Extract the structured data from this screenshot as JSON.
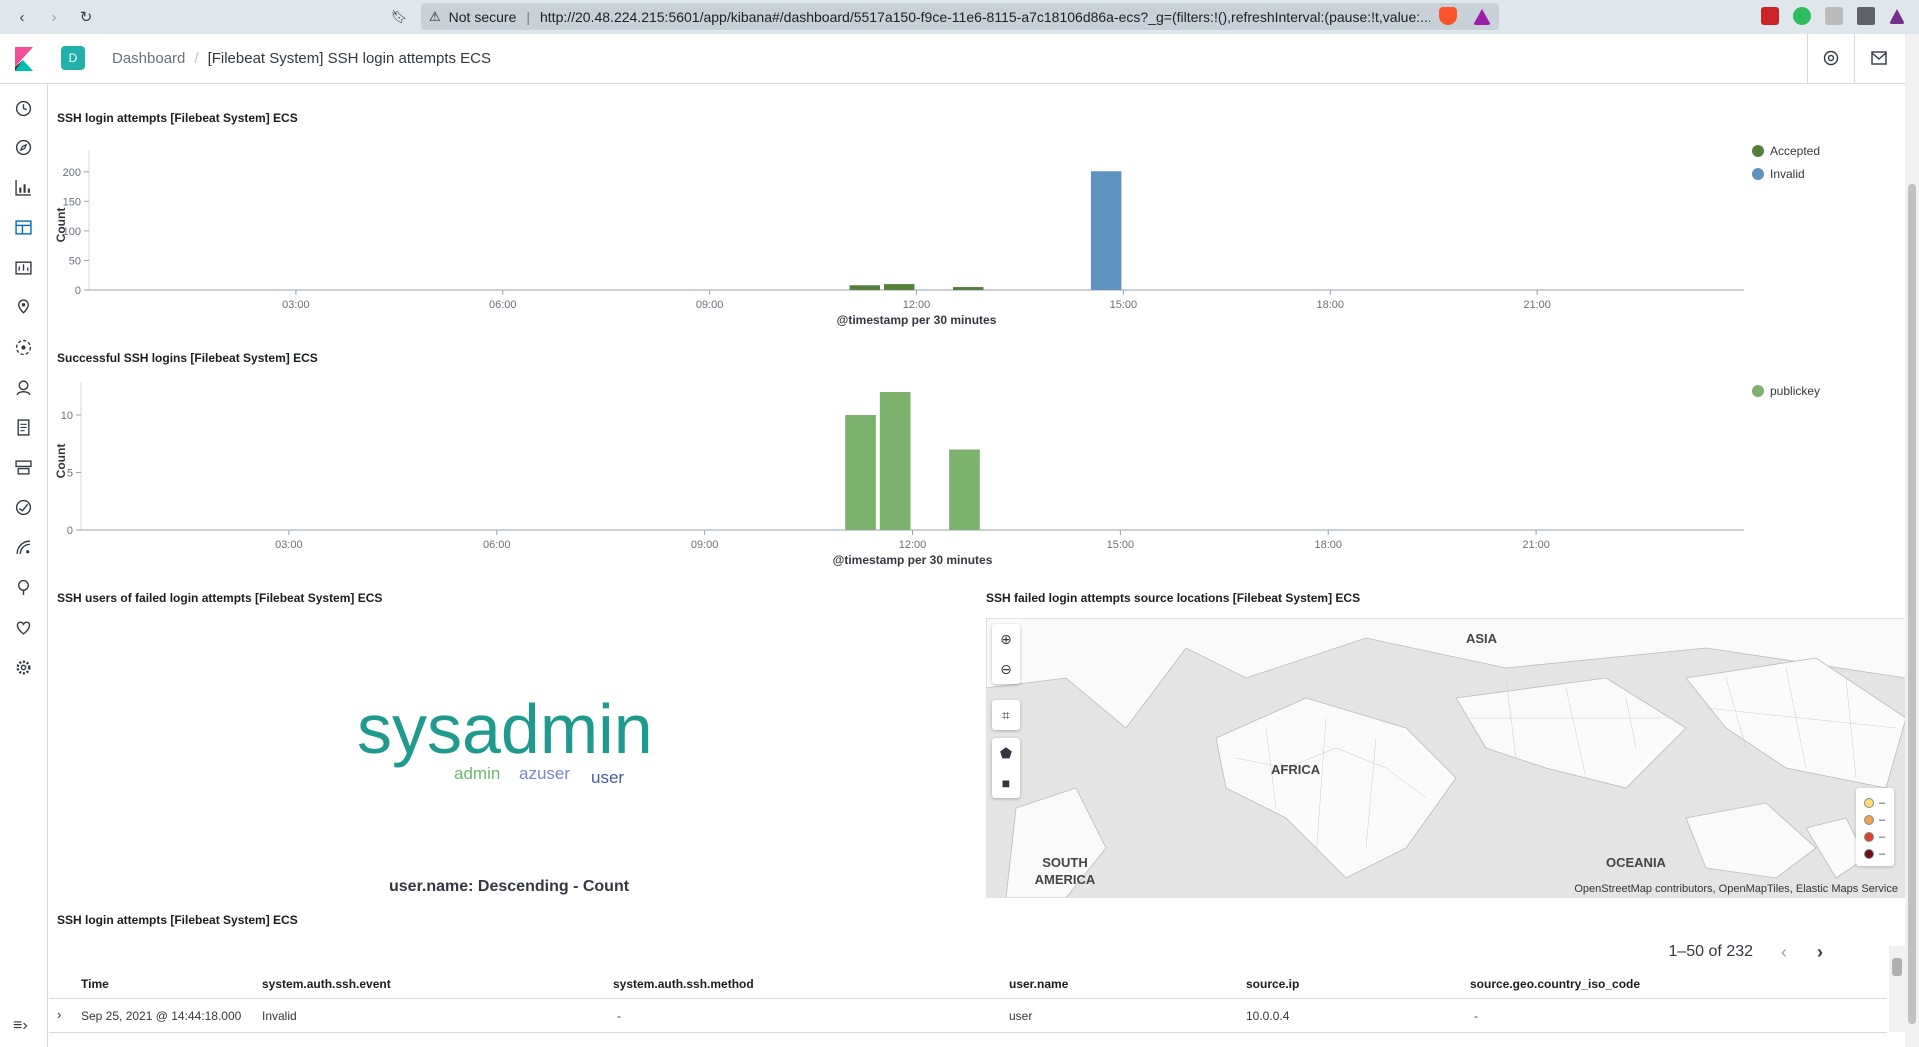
{
  "browser": {
    "security_label": "Not secure",
    "url": "http://20.48.224.215:5601/app/kibana#/dashboard/5517a150-f9ce-11e6-8115-a7c18106d86a-ecs?_g=(filters:!(),refreshInterval:(pause:!t,value:..."
  },
  "header": {
    "space_initial": "D",
    "breadcrumb_root": "Dashboard",
    "breadcrumb_current": "[Filebeat System] SSH login attempts ECS"
  },
  "panels": {
    "attempts_title": "SSH login attempts [Filebeat System] ECS",
    "success_title": "Successful SSH logins [Filebeat System] ECS",
    "users_title": "SSH users of failed login attempts [Filebeat System] ECS",
    "map_title": "SSH failed login attempts source locations [Filebeat System] ECS",
    "table_title": "SSH login attempts [Filebeat System] ECS"
  },
  "chart_data": [
    {
      "type": "bar",
      "title": "SSH login attempts [Filebeat System] ECS",
      "xlabel": "@timestamp per 30 minutes",
      "ylabel": "Count",
      "x_ticks": [
        "03:00",
        "06:00",
        "09:00",
        "12:00",
        "15:00",
        "18:00",
        "21:00"
      ],
      "y_ticks": [
        0,
        50,
        100,
        150,
        200
      ],
      "ylim": [
        0,
        220
      ],
      "xlim_hours": [
        0,
        24
      ],
      "legend_position": "top-right",
      "series": [
        {
          "name": "Accepted",
          "color": "#54803b",
          "x_hours": [
            11.25,
            11.75,
            12.75
          ],
          "values": [
            8,
            10,
            5
          ]
        },
        {
          "name": "Invalid",
          "color": "#6092c0",
          "x_hours": [
            14.75
          ],
          "values": [
            201
          ]
        }
      ]
    },
    {
      "type": "bar",
      "title": "Successful SSH logins [Filebeat System] ECS",
      "xlabel": "@timestamp per 30 minutes",
      "ylabel": "Count",
      "x_ticks": [
        "03:00",
        "06:00",
        "09:00",
        "12:00",
        "15:00",
        "18:00",
        "21:00"
      ],
      "y_ticks": [
        0,
        5,
        10
      ],
      "ylim": [
        0,
        12
      ],
      "xlim_hours": [
        0,
        24
      ],
      "legend_position": "top-right",
      "series": [
        {
          "name": "publickey",
          "color": "#7db26e",
          "x_hours": [
            11.25,
            11.75,
            12.75
          ],
          "values": [
            10,
            12,
            7
          ]
        }
      ]
    }
  ],
  "word_cloud": {
    "words": [
      {
        "text": "sysadmin",
        "color": "#209a8e"
      },
      {
        "text": "admin",
        "color": "#6dba6d"
      },
      {
        "text": "azuser",
        "color": "#7b87c9"
      },
      {
        "text": "user",
        "color": "#4a5aa6"
      }
    ],
    "caption": "user.name: Descending - Count"
  },
  "map": {
    "labels": [
      "ASIA",
      "AFRICA",
      "SOUTH AMERICA",
      "OCEANIA"
    ],
    "attribution": "OpenStreetMap contributors, OpenMapTiles, Elastic Maps Service",
    "legend": [
      {
        "color": "#fbe06b",
        "label": "–"
      },
      {
        "color": "#f0a24a",
        "label": "–"
      },
      {
        "color": "#d9442c",
        "label": "–"
      },
      {
        "color": "#6e0f1a",
        "label": "–"
      }
    ]
  },
  "table": {
    "pagination": "1–50 of 232",
    "columns": [
      "Time",
      "system.auth.ssh.event",
      "system.auth.ssh.method",
      "user.name",
      "source.ip",
      "source.geo.country_iso_code"
    ],
    "rows": [
      {
        "time": "Sep 25, 2021 @ 14:44:18.000",
        "event": "Invalid",
        "method": "-",
        "user": "user",
        "ip": "10.0.0.4",
        "country": "-"
      }
    ]
  }
}
